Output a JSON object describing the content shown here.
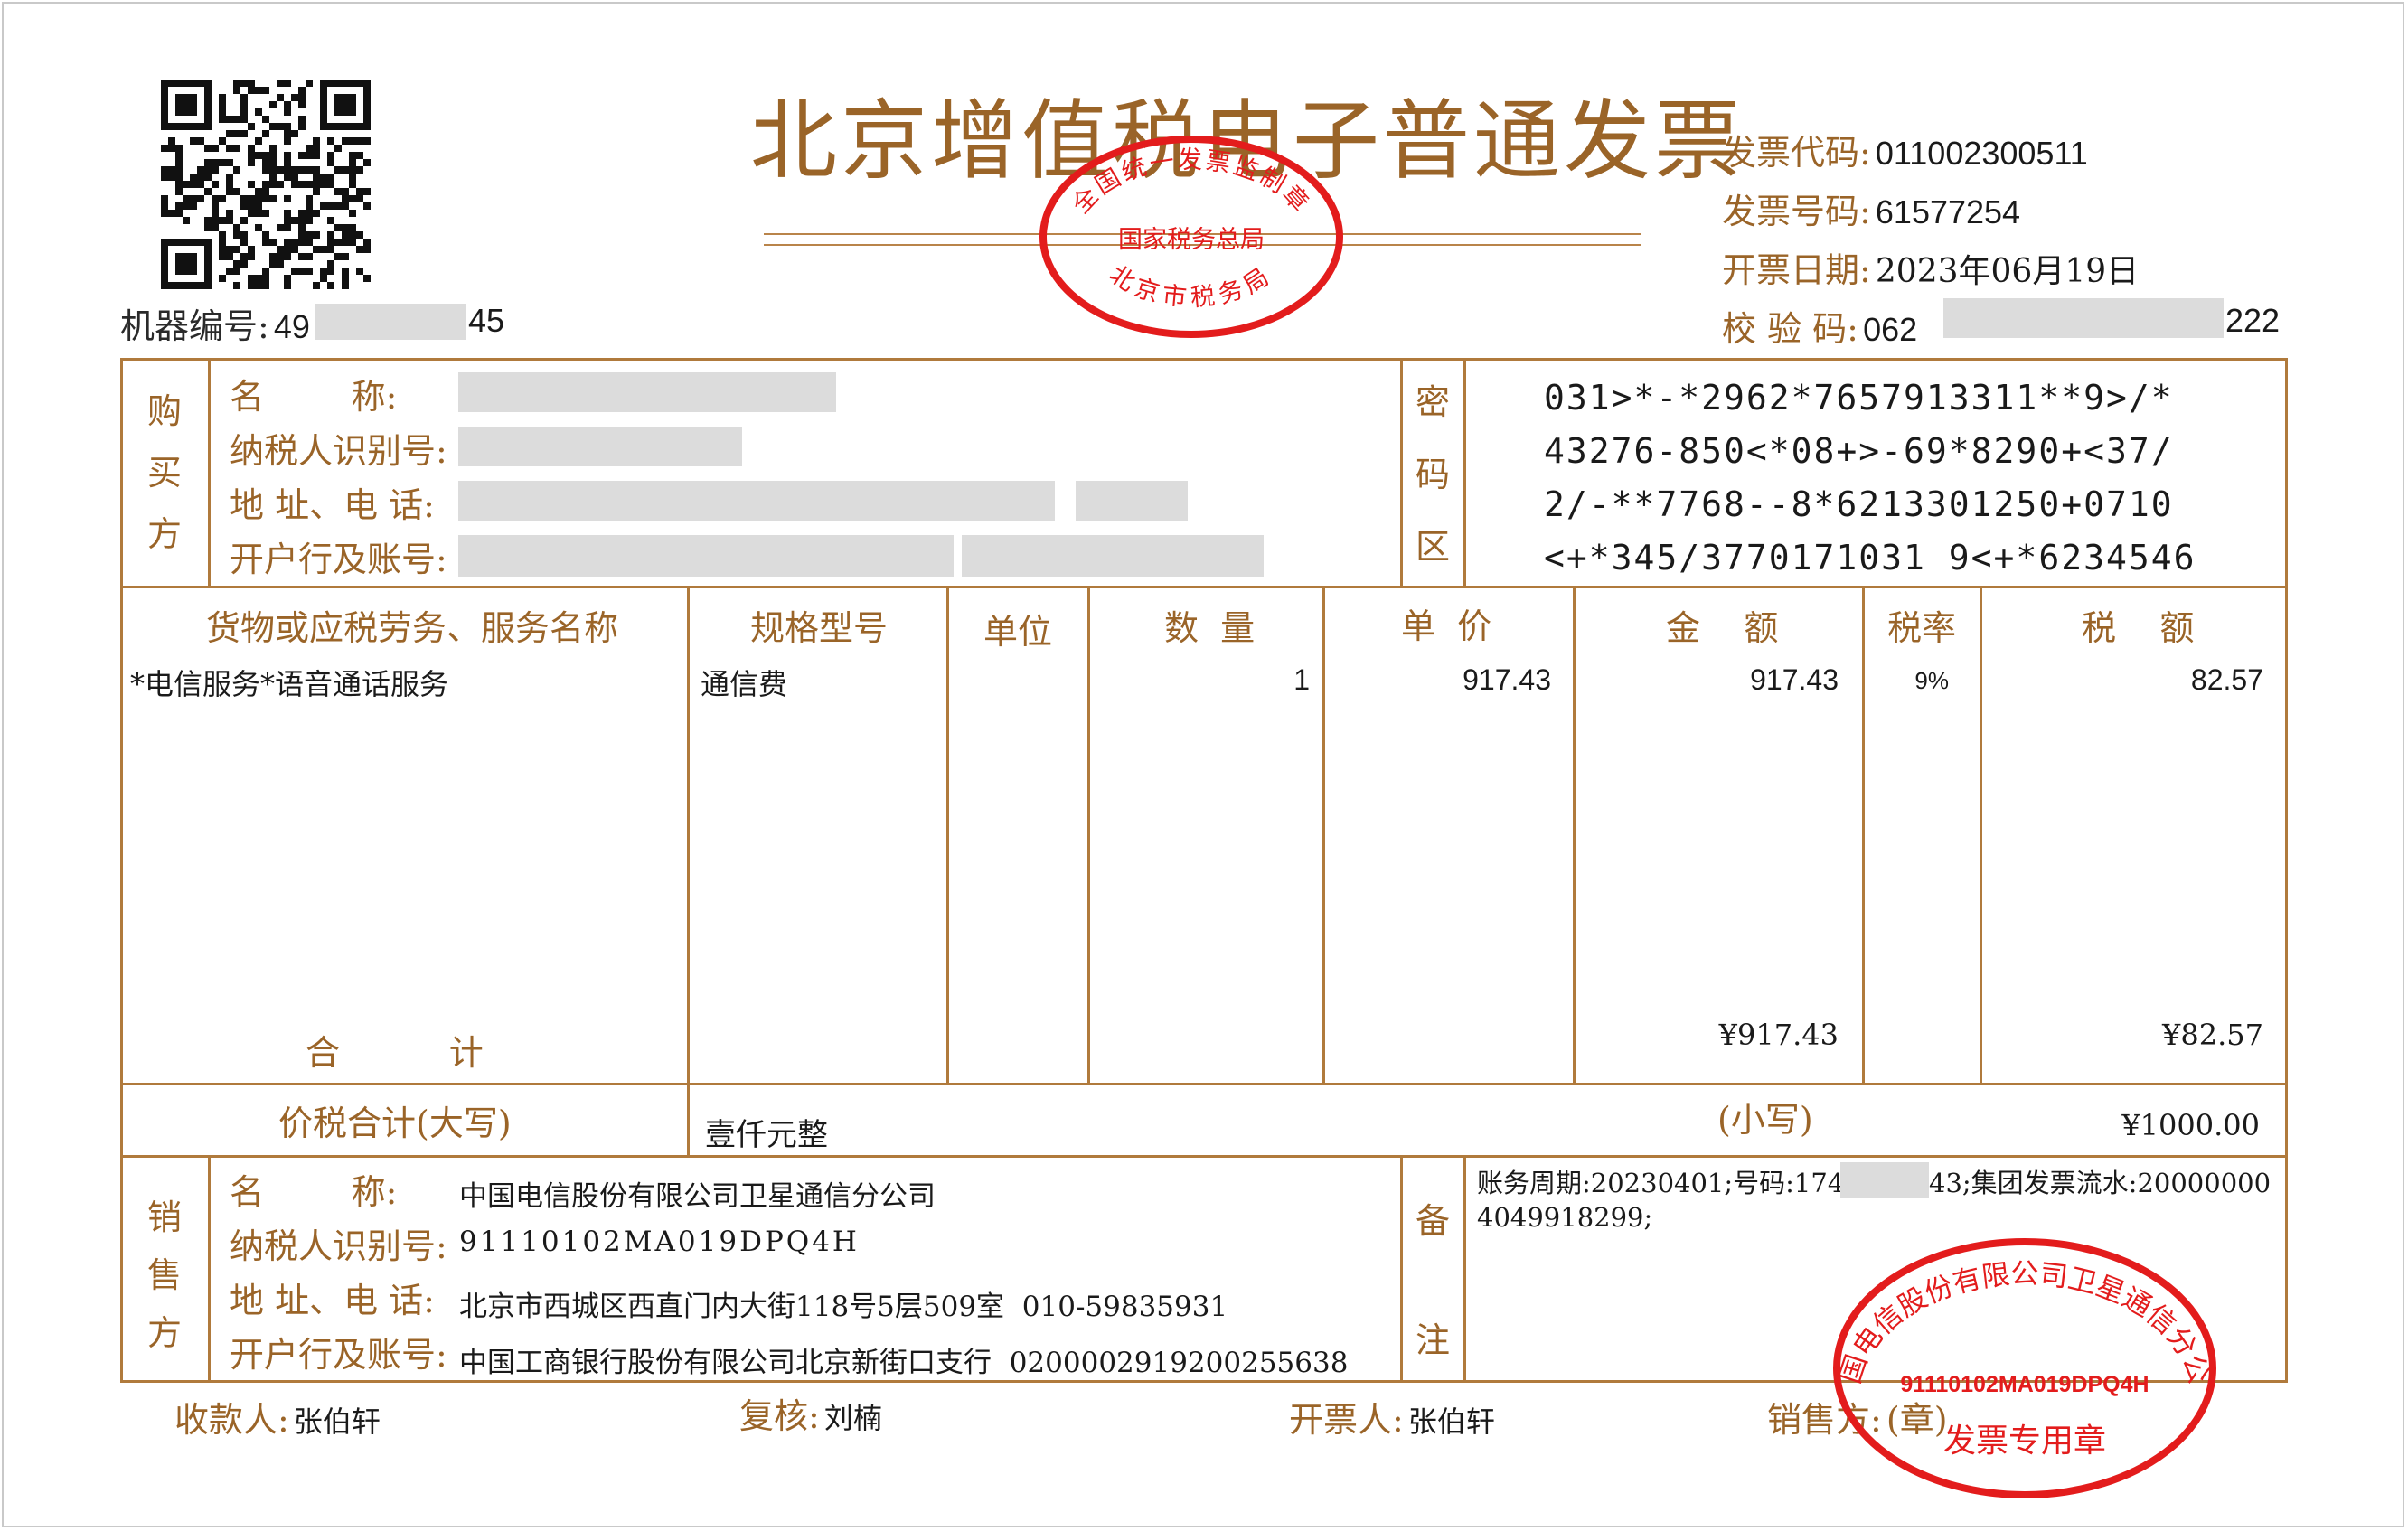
{
  "invoice": {
    "title": "北京增值税电子普通发票",
    "machine_no_label": "机器编号:",
    "machine_no_prefix": "49",
    "machine_no_suffix": "45",
    "code_label": "发票代码:",
    "code": "011002300511",
    "number_label": "发票号码:",
    "number": "61577254",
    "date_label": "开票日期:",
    "date": "2023年06月19日",
    "check_label": "校 验 码:",
    "check_prefix": "062",
    "check_suffix": "222"
  },
  "stamp_top": {
    "top_text": "全国统一发票监制章",
    "middle_text": "国家税务总局",
    "bottom_text": "北京市税务局"
  },
  "buyer": {
    "section_label": [
      "购",
      "买",
      "方"
    ],
    "name_label": "名        称:",
    "taxid_label": "纳税人识别号:",
    "address_label": "地 址、电 话:",
    "bank_label": "开户行及账号:"
  },
  "cipher_zone": {
    "label": [
      "密",
      "码",
      "区"
    ],
    "lines": [
      "031>*-*2962*7657913311**9>/*",
      "43276-850<*08+>-69*8290+<37/",
      "2/-**7768--8*6213301250+0710",
      "<+*345/3770171031 9<+*6234546"
    ]
  },
  "columns": {
    "item": "货物或应税劳务、服务名称",
    "spec": "规格型号",
    "unit": "单位",
    "qty": "数  量",
    "price": "单  价",
    "amount": "金    额",
    "rate": "税率",
    "tax": "税    额"
  },
  "items": [
    {
      "name": "*电信服务*语音通话服务",
      "spec": "通信费",
      "unit": "",
      "qty": "1",
      "price": "917.43",
      "amount": "917.43",
      "rate": "9%",
      "tax": "82.57"
    }
  ],
  "subtotal": {
    "label": "合          计",
    "amount": "¥917.43",
    "tax": "¥82.57"
  },
  "total": {
    "label": "价税合计(大写)",
    "words": "壹仟元整",
    "small_label": "(小写)",
    "small": "¥1000.00"
  },
  "seller": {
    "section_label": [
      "销",
      "售",
      "方"
    ],
    "name_label": "名        称:",
    "name": "中国电信股份有限公司卫星通信分公司",
    "taxid_label": "纳税人识别号:",
    "taxid": "91110102MA019DPQ4H",
    "address_label": "地 址、电 话:",
    "address": "北京市西城区西直门内大街118号5层509室  010-59835931",
    "bank_label": "开户行及账号:",
    "bank": "中国工商银行股份有限公司北京新街口支行  0200002919200255638"
  },
  "remarks": {
    "label": [
      "备",
      "注"
    ],
    "line1_a": "账务周期:20230401;号码:174",
    "line1_b": "43;集团发票流水:20000000",
    "line2": "4049918299;"
  },
  "stamp_seller": {
    "arc_text": "中国电信股份有限公司卫星通信分公司",
    "taxid": "91110102MA019DPQ4H",
    "bottom_text": "发票专用章"
  },
  "footer": {
    "payee_label": "收款人:",
    "payee": "张伯轩",
    "reviewer_label": "复核:",
    "reviewer": "刘楠",
    "issuer_label": "开票人:",
    "issuer": "张伯轩",
    "seller_label": "销售方:",
    "seller_seal": "(章)"
  },
  "colors": {
    "label_brown": "#9a6428",
    "border_brown": "#b07a3c",
    "stamp_red": "#e31c1c",
    "redaction_gray": "#dcdcdc"
  }
}
